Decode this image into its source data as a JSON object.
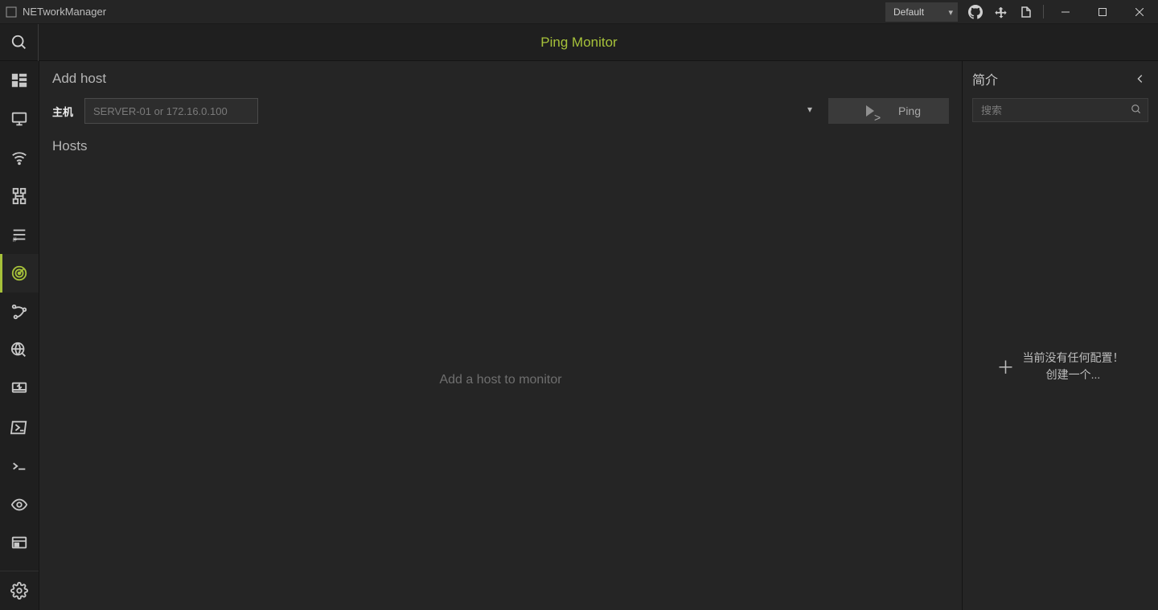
{
  "app": {
    "title": "NETworkManager"
  },
  "titlebar": {
    "profile_selected": "Default",
    "icons": {
      "github": "github-icon",
      "komorebi": "app-helper-icon",
      "docs": "docs-icon"
    }
  },
  "page": {
    "title": "Ping Monitor"
  },
  "sidebar": {
    "items": [
      {
        "name": "dashboard-icon",
        "active": false
      },
      {
        "name": "network-interface-icon",
        "active": false
      },
      {
        "name": "wifi-icon",
        "active": false
      },
      {
        "name": "ip-scanner-icon",
        "active": false
      },
      {
        "name": "port-scanner-icon",
        "active": false
      },
      {
        "name": "ping-monitor-icon",
        "active": true
      },
      {
        "name": "traceroute-icon",
        "active": false
      },
      {
        "name": "dns-lookup-icon",
        "active": false
      },
      {
        "name": "remote-desktop-icon",
        "active": false
      },
      {
        "name": "powershell-icon",
        "active": false
      },
      {
        "name": "putty-icon",
        "active": false
      },
      {
        "name": "tigervnc-icon",
        "active": false
      },
      {
        "name": "web-console-icon",
        "active": false
      }
    ],
    "settings_name": "settings-icon"
  },
  "main": {
    "add_host_title": "Add host",
    "host_label": "主机",
    "host_placeholder": "SERVER-01 or 172.16.0.100",
    "ping_button": "Ping",
    "hosts_title": "Hosts",
    "hosts_empty": "Add a host to monitor"
  },
  "profiles": {
    "title": "简介",
    "search_placeholder": "搜索",
    "empty_line1": "当前没有任何配置！",
    "empty_line2": "创建一个..."
  }
}
